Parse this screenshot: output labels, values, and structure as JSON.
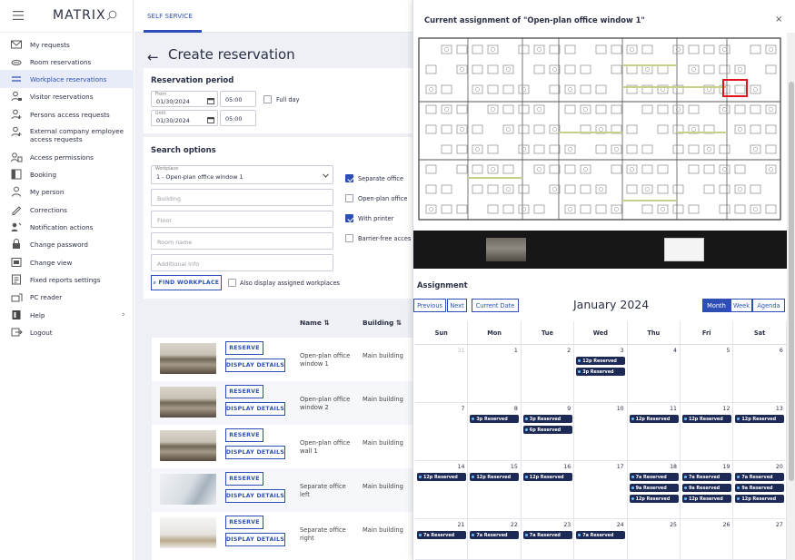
{
  "sidebar": {
    "title": "MATRIX",
    "items": [
      {
        "label": "My requests",
        "icon": "envelope-icon"
      },
      {
        "label": "Room reservations",
        "icon": "room-icon"
      },
      {
        "label": "Workplace reservations",
        "icon": "desk-icon"
      },
      {
        "label": "Visitor reservations",
        "icon": "visitor-icon"
      },
      {
        "label": "Persons access requests",
        "icon": "person-add-icon"
      },
      {
        "label": "External company employee access requests",
        "icon": "person-add-icon"
      },
      {
        "label": "Access permissions",
        "icon": "permission-icon"
      },
      {
        "label": "Booking",
        "icon": "booking-icon"
      },
      {
        "label": "My person",
        "icon": "person-icon"
      },
      {
        "label": "Corrections",
        "icon": "pen-icon"
      },
      {
        "label": "Notification actions",
        "icon": "notification-icon"
      },
      {
        "label": "Change password",
        "icon": "lock-icon"
      },
      {
        "label": "Change view",
        "icon": "view-icon"
      },
      {
        "label": "Fixed reports settings",
        "icon": "report-icon"
      },
      {
        "label": "PC reader",
        "icon": "reader-icon"
      },
      {
        "label": "Help",
        "icon": "help-icon"
      },
      {
        "label": "Logout",
        "icon": "logout-icon"
      }
    ]
  },
  "topbar": {
    "tab": "SELF SERVICE"
  },
  "page": {
    "title": "Create reservation"
  },
  "period": {
    "title": "Reservation period",
    "from_label": "From",
    "from_date": "01/30/2024",
    "from_time": "05:00",
    "until_label": "Until",
    "until_date": "01/30/2024",
    "until_time": "05:00",
    "full_day": "Full day"
  },
  "search": {
    "title": "Search options",
    "workplace_label": "Workplace",
    "workplace_value": "1 - Open-plan office window 1",
    "building_ph": "Building",
    "floor_ph": "Floor",
    "room_ph": "Room name",
    "info_ph": "Additional info",
    "chk_separate": "Separate office",
    "chk_openplan": "Open-plan office",
    "chk_printer": "With printer",
    "chk_barrier": "Barrier-free acces",
    "find_button": "FIND WORKPLACE",
    "display_assigned": "Also display assigned workplaces"
  },
  "results": {
    "col_name": "Name ⇅",
    "col_building": "Building ⇅",
    "reserve_label": "RESERVE",
    "details_label": "DISPLAY DETAILS",
    "rows": [
      {
        "name": "Open-plan office window 1",
        "building": "Main building",
        "photo": "openplan"
      },
      {
        "name": "Open-plan office window 2",
        "building": "Main building",
        "photo": "openplan"
      },
      {
        "name": "Open-plan office wall 1",
        "building": "Main building",
        "photo": "openplan"
      },
      {
        "name": "Separate office left",
        "building": "Main building",
        "photo": "separate"
      },
      {
        "name": "Separate office right",
        "building": "Main building",
        "photo": "separate2"
      }
    ]
  },
  "panel": {
    "title": "Current assignment of \"Open-plan office window 1\"",
    "close": "×",
    "assignment": "Assignment"
  },
  "calendar": {
    "prev": "Previous",
    "next": "Next",
    "current": "Current Date",
    "month": "January 2024",
    "views": [
      "Month",
      "Week",
      "Agenda"
    ],
    "active_view": "Month",
    "weekdays": [
      "Sun",
      "Mon",
      "Tue",
      "Wed",
      "Thu",
      "Fri",
      "Sat"
    ],
    "weeks": [
      [
        {
          "d": "31",
          "dim": true,
          "ev": []
        },
        {
          "d": "1",
          "ev": []
        },
        {
          "d": "2",
          "ev": []
        },
        {
          "d": "3",
          "ev": [
            "12p Reserved",
            "3p Reserved"
          ]
        },
        {
          "d": "4",
          "ev": []
        },
        {
          "d": "5",
          "ev": []
        },
        {
          "d": "6",
          "ev": []
        }
      ],
      [
        {
          "d": "7",
          "ev": []
        },
        {
          "d": "8",
          "ev": [
            "3p Reserved"
          ]
        },
        {
          "d": "9",
          "ev": [
            "3p Reserved",
            "6p Reserved"
          ]
        },
        {
          "d": "10",
          "ev": []
        },
        {
          "d": "11",
          "ev": [
            "12p Reserved"
          ]
        },
        {
          "d": "12",
          "ev": [
            "12p Reserved"
          ]
        },
        {
          "d": "13",
          "ev": [
            "12p Reserved"
          ]
        }
      ],
      [
        {
          "d": "14",
          "ev": [
            "12p Reserved"
          ]
        },
        {
          "d": "15",
          "ev": [
            "12p Reserved"
          ]
        },
        {
          "d": "16",
          "ev": [
            "12p Reserved"
          ]
        },
        {
          "d": "17",
          "ev": []
        },
        {
          "d": "18",
          "ev": [
            "7a Reserved",
            "9a Reserved",
            "12p Reserved"
          ]
        },
        {
          "d": "19",
          "ev": [
            "7a Reserved",
            "9a Reserved",
            "12p Reserved"
          ]
        },
        {
          "d": "20",
          "ev": [
            "7a Reserved",
            "9a Reserved",
            "12p Reserved"
          ]
        }
      ],
      [
        {
          "d": "21",
          "ev": [
            "7a Reserved"
          ]
        },
        {
          "d": "22",
          "ev": [
            "7a Reserved"
          ]
        },
        {
          "d": "23",
          "ev": [
            "7a Reserved"
          ]
        },
        {
          "d": "24",
          "ev": [
            "7a Reserved"
          ]
        },
        {
          "d": "25",
          "ev": []
        },
        {
          "d": "26",
          "ev": []
        },
        {
          "d": "27",
          "ev": []
        }
      ]
    ]
  },
  "colors": {
    "accent": "#2d4fb5",
    "event": "#1d2a55",
    "highlight": "#e0141e"
  }
}
